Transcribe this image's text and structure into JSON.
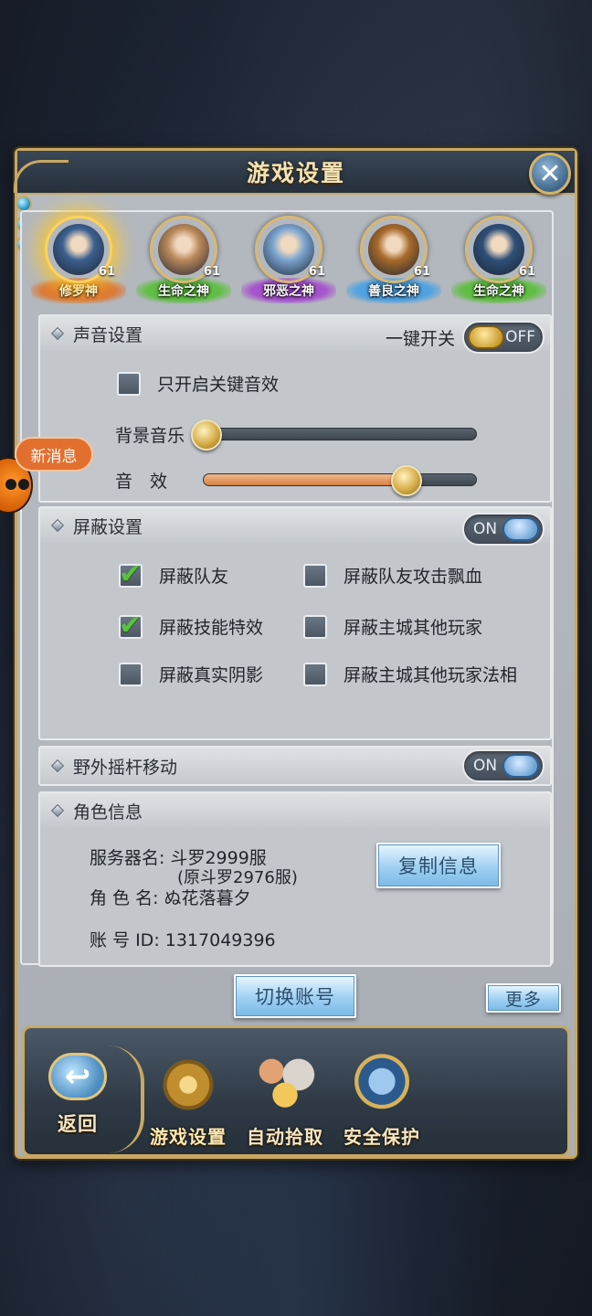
{
  "dialog": {
    "title": "游戏设置",
    "close_icon": "close-icon",
    "colors": {
      "frame_gold": "#c9a862",
      "panel_grey": "#b7bcc2",
      "accent_blue": "#7ab9e6",
      "slider_fill": "#d98246"
    }
  },
  "heroes": [
    {
      "name": "修罗神",
      "level": "61",
      "selected": true,
      "tag_color": "#e36a1a",
      "face_color": "#3b5f8e"
    },
    {
      "name": "生命之神",
      "level": "61",
      "selected": false,
      "tag_color": "#4fbf2a",
      "face_color": "#b9885a"
    },
    {
      "name": "邪恶之神",
      "level": "61",
      "selected": false,
      "tag_color": "#a33fd1",
      "face_color": "#7aa4cf"
    },
    {
      "name": "善良之神",
      "level": "61",
      "selected": false,
      "tag_color": "#3a9de8",
      "face_color": "#a86a2a"
    },
    {
      "name": "生命之神",
      "level": "61",
      "selected": false,
      "tag_color": "#4fbf2a",
      "face_color": "#2f4f78"
    }
  ],
  "sound": {
    "title": "声音设置",
    "onekey_label": "一键开关",
    "toggle_state": "OFF",
    "key_sound_only": {
      "label": "只开启关键音效",
      "checked": false
    },
    "bgm": {
      "label": "背景音乐",
      "level": 0
    },
    "sfx": {
      "label": "音　效",
      "level": 0.75
    }
  },
  "block": {
    "title": "屏蔽设置",
    "toggle_state": "ON",
    "options": [
      {
        "label": "屏蔽队友",
        "checked": true
      },
      {
        "label": "屏蔽队友攻击飘血",
        "checked": false
      },
      {
        "label": "屏蔽技能特效",
        "checked": true
      },
      {
        "label": "屏蔽主城其他玩家",
        "checked": false
      },
      {
        "label": "屏蔽真实阴影",
        "checked": false
      },
      {
        "label": "屏蔽主城其他玩家法相",
        "checked": false
      }
    ]
  },
  "joystick": {
    "title": "野外摇杆移动",
    "toggle_state": "ON"
  },
  "role": {
    "title": "角色信息",
    "server_line": "服务器名: 斗罗2999服",
    "server_orig": "(原斗罗2976服)",
    "role_line": "角 色 名: ぬ花落暮夕",
    "account_line": "账 号 ID: 1317049396",
    "copy_button": "复制信息"
  },
  "switch_account": "切换账号",
  "more": "更多",
  "news_bubble": "新消息",
  "bottom_nav": {
    "back": "返回",
    "items": [
      {
        "label": "游戏设置",
        "icon": "gear-icon",
        "active": true
      },
      {
        "label": "自动拾取",
        "icon": "coin-bag-icon",
        "active": false
      },
      {
        "label": "安全保护",
        "icon": "shield-lock-icon",
        "active": false
      }
    ]
  }
}
